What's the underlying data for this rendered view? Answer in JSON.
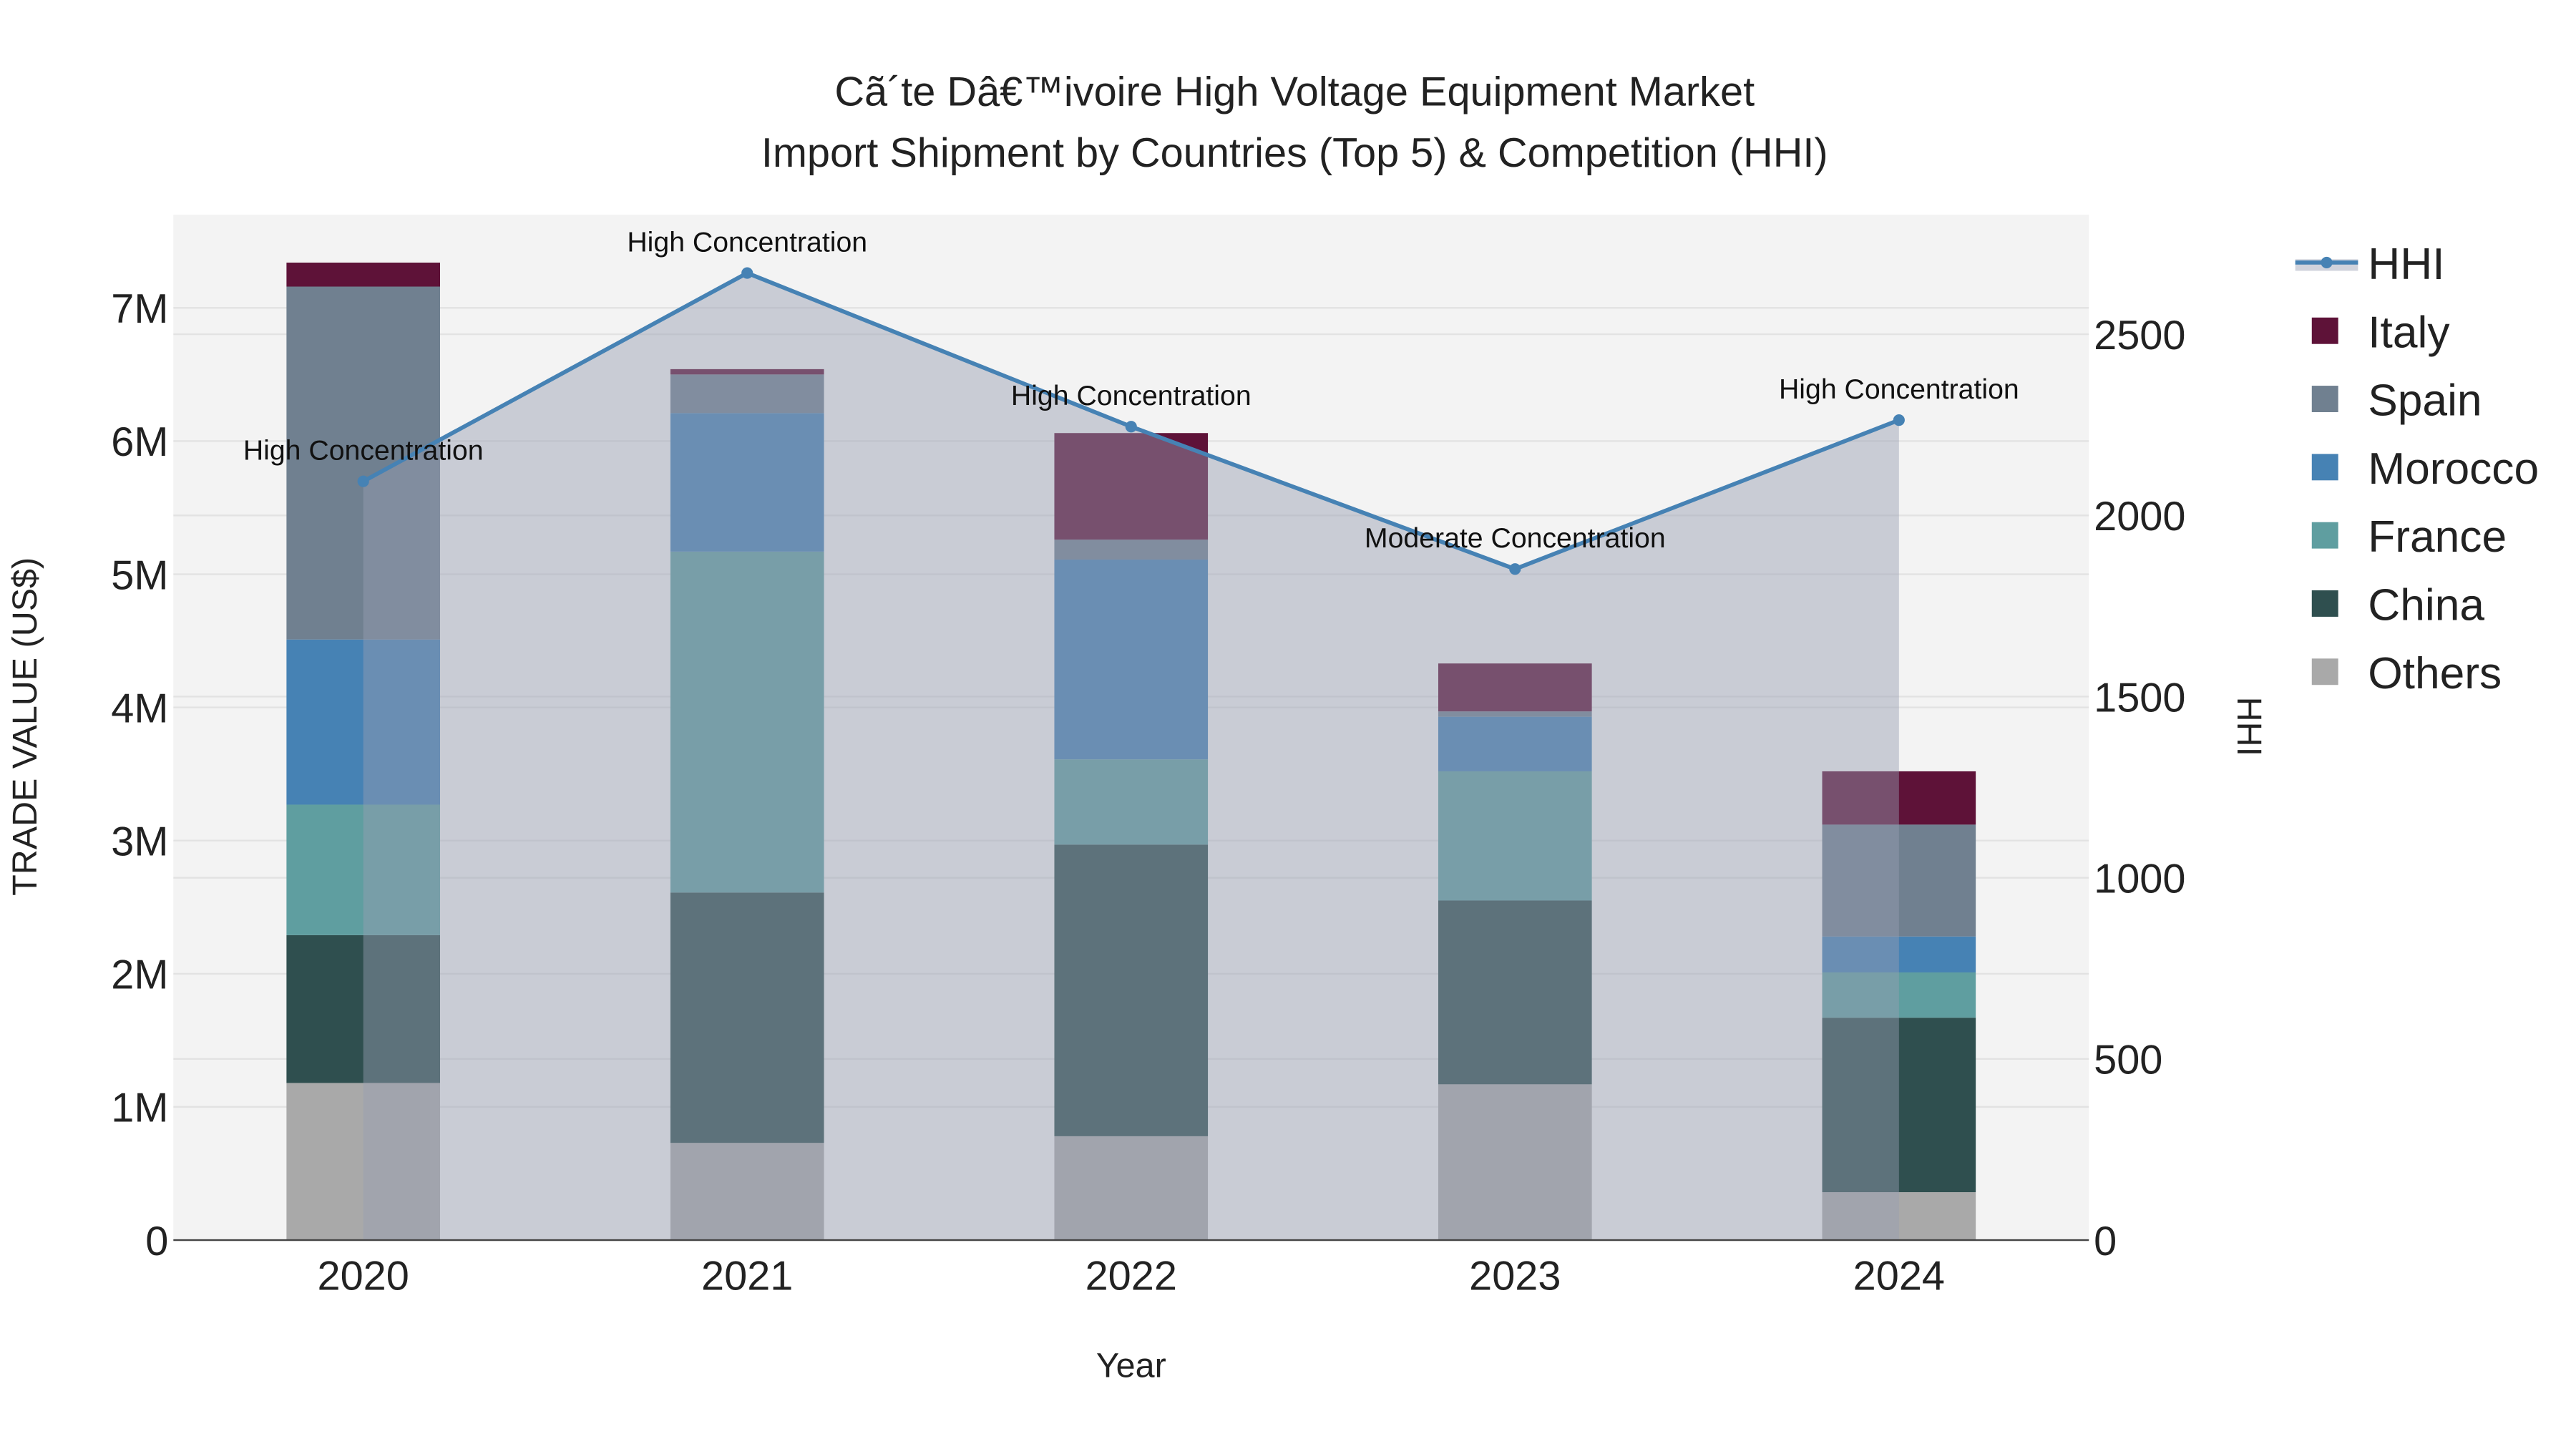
{
  "chart_data": {
    "type": "bar",
    "stacked": true,
    "title_line1": "Cã´te Dâ€™ivoire High Voltage Equipment Market",
    "title_line2": "Import Shipment by Countries (Top 5) & Competition (HHI)",
    "xlabel": "Year",
    "ylabel": "TRADE VALUE (US$)",
    "y2label": "HHI",
    "categories": [
      "2020",
      "2021",
      "2022",
      "2023",
      "2024"
    ],
    "ylim": [
      0,
      7700000
    ],
    "y2lim": [
      0,
      2830
    ],
    "yticks": [
      {
        "v": 0,
        "label": "0"
      },
      {
        "v": 1000000,
        "label": "1M"
      },
      {
        "v": 2000000,
        "label": "2M"
      },
      {
        "v": 3000000,
        "label": "3M"
      },
      {
        "v": 4000000,
        "label": "4M"
      },
      {
        "v": 5000000,
        "label": "5M"
      },
      {
        "v": 6000000,
        "label": "6M"
      },
      {
        "v": 7000000,
        "label": "7M"
      }
    ],
    "y2ticks": [
      {
        "v": 0,
        "label": "0"
      },
      {
        "v": 500,
        "label": "500"
      },
      {
        "v": 1000,
        "label": "1000"
      },
      {
        "v": 1500,
        "label": "1500"
      },
      {
        "v": 2000,
        "label": "2000"
      },
      {
        "v": 2500,
        "label": "2500"
      }
    ],
    "series": [
      {
        "name": "Others",
        "color": "#a9a9a9",
        "values": [
          1180000,
          730000,
          780000,
          1170000,
          360000
        ]
      },
      {
        "name": "China",
        "color": "#2f4f4f",
        "values": [
          1110000,
          1880000,
          2190000,
          1380000,
          1310000
        ]
      },
      {
        "name": "France",
        "color": "#5f9ea0",
        "values": [
          980000,
          2560000,
          640000,
          970000,
          340000
        ]
      },
      {
        "name": "Morocco",
        "color": "#4682b4",
        "values": [
          1240000,
          1040000,
          1500000,
          410000,
          270000
        ]
      },
      {
        "name": "Spain",
        "color": "#708090",
        "values": [
          2650000,
          290000,
          150000,
          40000,
          840000
        ]
      },
      {
        "name": "Italy",
        "color": "#5e1238",
        "values": [
          180000,
          40000,
          800000,
          360000,
          400000
        ]
      }
    ],
    "hhi": {
      "name": "HHI",
      "color": "#4682b4",
      "values": [
        2094,
        2669,
        2245,
        1852,
        2263
      ],
      "annotations": [
        "High Concentration",
        "High Concentration",
        "High Concentration",
        "Moderate Concentration",
        "High Concentration"
      ]
    },
    "legend_order": [
      "HHI",
      "Italy",
      "Spain",
      "Morocco",
      "France",
      "China",
      "Others"
    ],
    "legend_placement": "right",
    "grid": true
  }
}
